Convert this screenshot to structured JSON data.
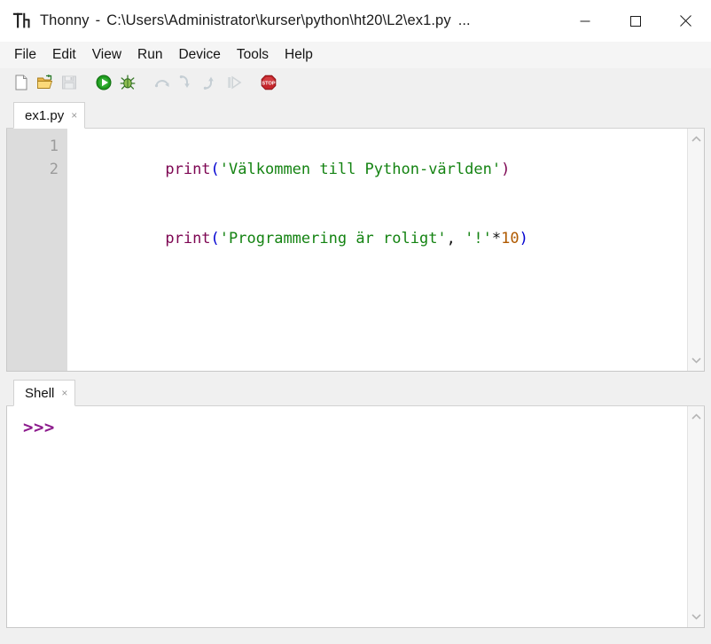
{
  "window": {
    "app_name": "Thonny",
    "separator": "-",
    "file_path": "C:\\Users\\Administrator\\kurser\\python\\ht20\\L2\\ex1.py",
    "title_overflow": "...",
    "logo_text": "Th",
    "controls": [
      {
        "name": "minimize",
        "glyph": "minimize-icon"
      },
      {
        "name": "maximize",
        "glyph": "maximize-icon"
      },
      {
        "name": "close",
        "glyph": "close-icon"
      }
    ]
  },
  "menubar": {
    "items": [
      {
        "label": "File"
      },
      {
        "label": "Edit"
      },
      {
        "label": "View"
      },
      {
        "label": "Run"
      },
      {
        "label": "Device"
      },
      {
        "label": "Tools"
      },
      {
        "label": "Help"
      }
    ]
  },
  "toolbar": {
    "buttons": [
      {
        "name": "new-file-icon",
        "title": "New",
        "enabled": true
      },
      {
        "name": "open-file-icon",
        "title": "Load",
        "enabled": true
      },
      {
        "name": "save-file-icon",
        "title": "Save",
        "enabled": false
      },
      {
        "name": "run-icon",
        "title": "Run",
        "enabled": true
      },
      {
        "name": "debug-icon",
        "title": "Debug",
        "enabled": true
      },
      {
        "name": "step-over-icon",
        "title": "Step over",
        "enabled": false
      },
      {
        "name": "step-into-icon",
        "title": "Step into",
        "enabled": false
      },
      {
        "name": "step-out-icon",
        "title": "Step out",
        "enabled": false
      },
      {
        "name": "resume-icon",
        "title": "Resume",
        "enabled": false
      },
      {
        "name": "stop-icon",
        "title": "Stop",
        "enabled": true
      }
    ]
  },
  "editor": {
    "tab": {
      "label": "ex1.py",
      "close_glyph": "×"
    },
    "line_numbers": [
      "1",
      "2"
    ],
    "lines": [
      {
        "number": "1",
        "tokens": [
          {
            "text": "print",
            "type": "fn"
          },
          {
            "text": "(",
            "type": "paren"
          },
          {
            "text": "'Välkommen till Python-världen'",
            "type": "str"
          },
          {
            "text": ")",
            "type": "paren2"
          }
        ]
      },
      {
        "number": "2",
        "tokens": [
          {
            "text": "print",
            "type": "fn"
          },
          {
            "text": "(",
            "type": "paren"
          },
          {
            "text": "'Programmering är roligt'",
            "type": "str"
          },
          {
            "text": ",",
            "type": "op"
          },
          {
            "text": " ",
            "type": "op"
          },
          {
            "text": "'!'",
            "type": "str"
          },
          {
            "text": "*",
            "type": "op"
          },
          {
            "text": "10",
            "type": "num"
          },
          {
            "text": ")",
            "type": "paren"
          }
        ]
      }
    ]
  },
  "shell": {
    "tab": {
      "label": "Shell",
      "close_glyph": "×"
    },
    "prompt": ">>>"
  },
  "colors": {
    "function": "#7d0552",
    "string": "#148312",
    "number": "#b05a00",
    "paren": "#0000d0",
    "prompt": "#8c1a8c",
    "gutter_bg": "#dcdcdc",
    "gutter_fg": "#9b9b9b",
    "chrome_bg": "#f0f0f0",
    "run_green": "#1f9b1f",
    "stop_red": "#c5262b"
  }
}
